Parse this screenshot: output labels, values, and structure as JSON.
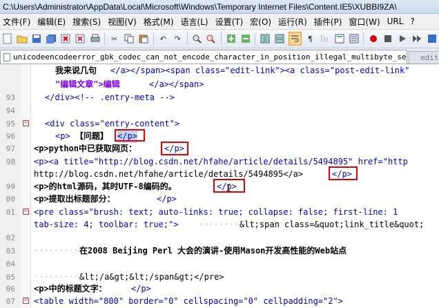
{
  "window": {
    "title": "C:\\Users\\Administrator\\AppData\\Local\\Microsoft\\Windows\\Temporary Internet Files\\Content.IE5\\XUBBI9ZA\\"
  },
  "menu": [
    "文件(F)",
    "编辑(E)",
    "搜索(S)",
    "视图(V)",
    "格式(M)",
    "语言(L)",
    "设置(T)",
    "宏(O)",
    "运行(R)",
    "插件(P)",
    "窗口(W)",
    "URL",
    "?"
  ],
  "toolbar": [
    "new-file",
    "open-file",
    "save",
    "save-all",
    "close",
    "close-all",
    "print",
    "cut",
    "copy",
    "paste",
    "undo",
    "redo",
    "find",
    "replace",
    "zoom-in",
    "zoom-out",
    "sync-v",
    "sync-h",
    "word-wrap",
    "show-all",
    "indent-guide",
    "doc-map",
    "func-list",
    "record-macro",
    "stop-macro",
    "play-macro",
    "run-macro",
    "save-macro"
  ],
  "tabs": {
    "active": "unicodeencodeerror_gbk_codec_can_not_encode_character_in_position_illegal_multibyte_sequence[1]",
    "next": "edit"
  },
  "lines": [
    {
      "num": "",
      "text_a": "我来说几句",
      "text_b": "</a></span><span class=\"edit-link\"><a class=\"post-edit-link\""
    },
    {
      "num": "",
      "text_a": "\"编辑文章\">编辑",
      "text_b": "</a></span>"
    },
    {
      "num": "93",
      "text": "</div><!-- .entry-meta -->"
    },
    {
      "num": "94",
      "text": ""
    },
    {
      "num": "95",
      "text_a": "<div class=\"entry-content\">"
    },
    {
      "num": "96",
      "text_a": "<p>",
      "text_b": "【问题】",
      "text_c": "</p>"
    },
    {
      "num": "97",
      "text_a": "<p>python中已获取网页：",
      "text_b": "</p>"
    },
    {
      "num": "98",
      "text_a": "<p><a title=\"http://blog.csdn.net/hfahe/article/details/5494895\" href=\"http"
    },
    {
      "num": "",
      "text_a": "http://blog.csdn.net/hfahe/article/details/5494895</a>",
      "text_b": "</p>"
    },
    {
      "num": "99",
      "text_a": "<p>的html源码，其时UTF-8编码的。",
      "text_b": "</p>"
    },
    {
      "num": "00",
      "text_a": "<p>提取出标题部分：",
      "text_b": "</p>"
    },
    {
      "num": "01",
      "text_a": "<pre class=\"brush: text; auto-links: true; collapse: false; first-line: 1"
    },
    {
      "num": "",
      "text_a": "tab-size: 4; toolbar: true;\">",
      "text_b": "&lt;span class=&quot;link_title&quot;"
    },
    {
      "num": "02",
      "text": ""
    },
    {
      "num": "03",
      "text_a": "在2008 Beijing Perl 大会的演讲-使用Mason开发高性能的Web站点"
    },
    {
      "num": "04",
      "text": ""
    },
    {
      "num": "05",
      "text_a": "&lt;/a&gt;&lt;/span&gt;</pre>"
    },
    {
      "num": "06",
      "text_a": "<p>中的标题文字：",
      "text_b": "</p>"
    },
    {
      "num": "07",
      "text_a": "<table width=\"800\" border=\"0\" cellspacing=\"0\" cellpadding=\"2\">"
    }
  ]
}
